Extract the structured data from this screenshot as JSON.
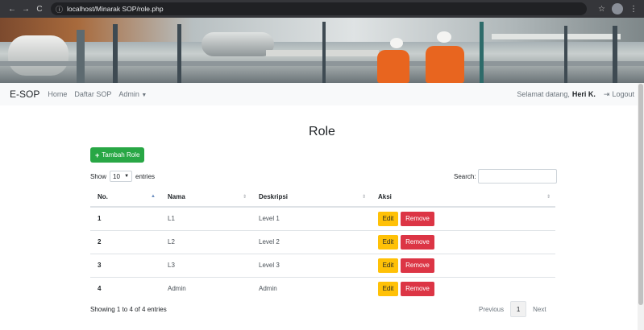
{
  "browser": {
    "url": "localhost/Minarak SOP/role.php",
    "nav_icons": [
      "back-icon",
      "forward-icon",
      "reload-icon"
    ],
    "right_icons": [
      "star-icon",
      "profile-icon",
      "menu-icon"
    ]
  },
  "navbar": {
    "brand": "E-SOP",
    "links": [
      "Home",
      "Daftar SOP",
      "Admin"
    ],
    "welcome_prefix": "Selamat datang,",
    "user": "Heri K.",
    "logout_label": "Logout"
  },
  "page": {
    "title": "Role",
    "add_button": "Tambah Role"
  },
  "table_controls": {
    "show_label": "Show",
    "entries_value": "10",
    "entries_label": "entries",
    "search_label": "Search:",
    "search_value": ""
  },
  "table": {
    "columns": [
      "No.",
      "Nama",
      "Deskripsi",
      "Aksi"
    ],
    "rows": [
      {
        "no": "1",
        "nama": "L1",
        "deskripsi": "Level 1"
      },
      {
        "no": "2",
        "nama": "L2",
        "deskripsi": "Level 2"
      },
      {
        "no": "3",
        "nama": "L3",
        "deskripsi": "Level 3"
      },
      {
        "no": "4",
        "nama": "Admin",
        "deskripsi": "Admin"
      }
    ],
    "edit_label": "Edit",
    "remove_label": "Remove"
  },
  "footer": {
    "info": "Showing 1 to 4 of 4 entries",
    "previous": "Previous",
    "current_page": "1",
    "next": "Next"
  },
  "colors": {
    "add": "#28a745",
    "edit": "#ffc107",
    "remove": "#dc3545"
  }
}
